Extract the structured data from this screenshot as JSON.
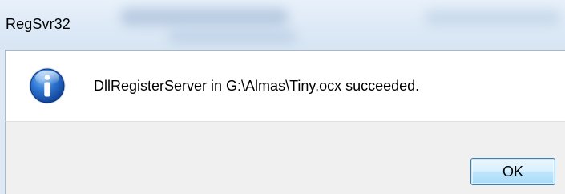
{
  "window": {
    "title": "RegSvr32"
  },
  "dialog": {
    "icon": "information-icon",
    "message": "DllRegisterServer in G:\\Almas\\Tiny.ocx succeeded.",
    "ok_label": "OK"
  },
  "colors": {
    "icon_blue": "#1c5fb8",
    "button_border": "#3c7fb1",
    "footer_bg": "#f0f0f0",
    "content_bg": "#ffffff"
  }
}
